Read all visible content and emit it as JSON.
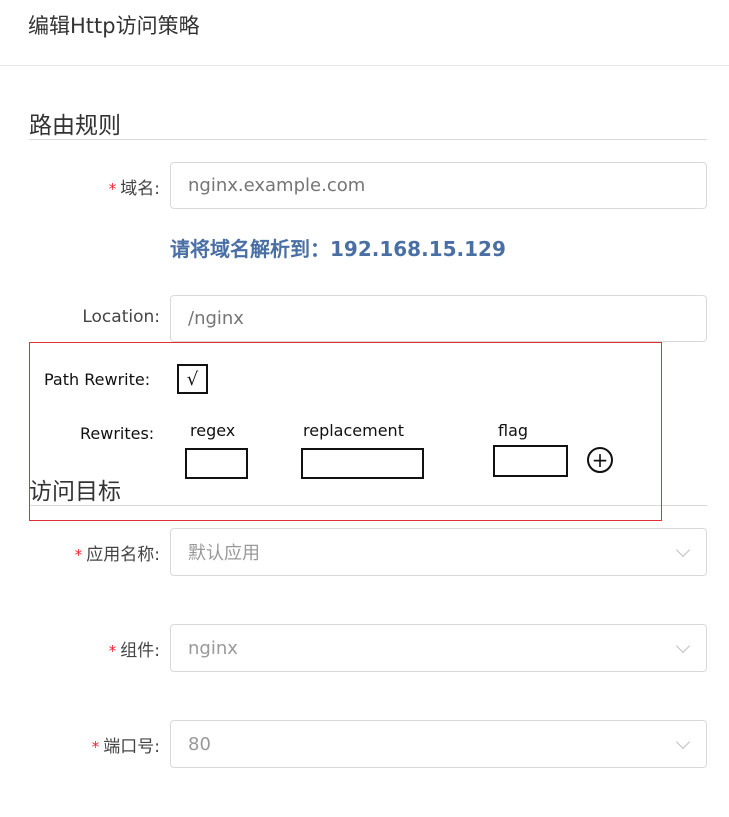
{
  "dialog": {
    "title": "编辑Http访问策略"
  },
  "routing": {
    "section_title": "路由规则",
    "domain": {
      "required_mark": "*",
      "label": "域名:",
      "placeholder": "nginx.example.com"
    },
    "resolve_hint": "请将域名解析到：192.168.15.129",
    "location": {
      "label": "Location:",
      "placeholder": "/nginx"
    }
  },
  "rewrite": {
    "path_rewrite_label": "Path Rewrite:",
    "path_rewrite_checked": "√",
    "rewrites_label": "Rewrites:",
    "columns": {
      "regex": "regex",
      "replacement": "replacement",
      "flag": "flag"
    },
    "add_symbol": "+"
  },
  "target": {
    "section_title": "访问目标",
    "app": {
      "required_mark": "*",
      "label": "应用名称:",
      "value": "默认应用"
    },
    "component": {
      "required_mark": "*",
      "label": "组件:",
      "value": "nginx"
    },
    "port": {
      "required_mark": "*",
      "label": "端口号:",
      "value": "80"
    }
  },
  "colors": {
    "required": "#f5222d",
    "hint": "#4a6fa5",
    "highlight_border": "#e0303a"
  }
}
